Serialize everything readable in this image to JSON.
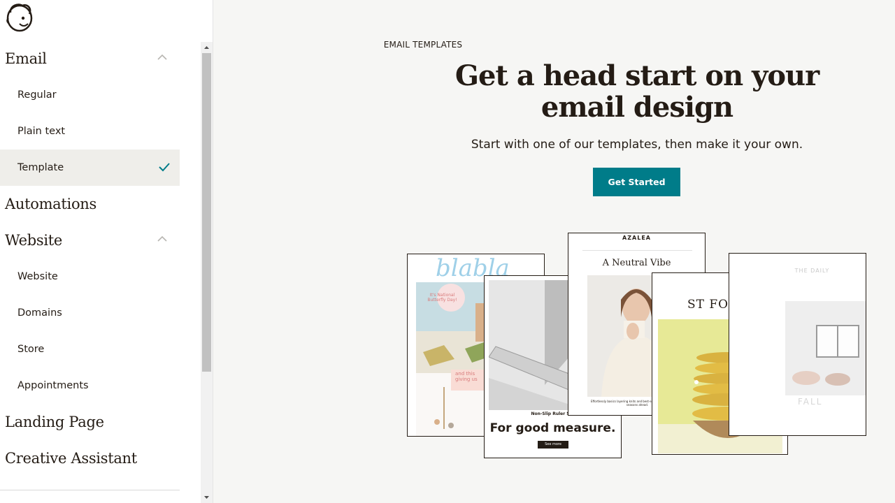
{
  "sidebar": {
    "logo": "mailchimp-freddie-logo",
    "groups": [
      {
        "title": "Email",
        "expanded": true,
        "items": [
          {
            "label": "Regular",
            "selected": false
          },
          {
            "label": "Plain text",
            "selected": false
          },
          {
            "label": "Template",
            "selected": true
          }
        ]
      },
      {
        "title": "Automations",
        "expanded": false,
        "items": []
      },
      {
        "title": "Website",
        "expanded": true,
        "items": [
          {
            "label": "Website",
            "selected": false
          },
          {
            "label": "Domains",
            "selected": false
          },
          {
            "label": "Store",
            "selected": false
          },
          {
            "label": "Appointments",
            "selected": false
          }
        ]
      },
      {
        "title": "Landing Page",
        "expanded": false,
        "items": []
      },
      {
        "title": "Creative Assistant",
        "expanded": false,
        "items": []
      }
    ]
  },
  "main": {
    "eyebrow": "EMAIL TEMPLATES",
    "headline": "Get a head start on your email design",
    "subhead": "Start with one of our templates, then make it your own.",
    "cta_label": "Get Started"
  },
  "cards": {
    "card1": {
      "script": "blabla",
      "bubble": "It's National Butterfly Day!",
      "caption": "and this giving us"
    },
    "card2": {
      "kicker": "Non-Slip Ruler Set",
      "title": "For good measure.",
      "button": "See more"
    },
    "card3": {
      "brand": "AZALEA",
      "title": "A Neutral Vibe",
      "caption": "Effortlessly basics layering knits and best-selling wrap tops for the seasons ahead."
    },
    "card4": {
      "title": "ST FORK"
    },
    "card5": {
      "brand": "THE DAILY",
      "caption": "FALL"
    }
  },
  "colors": {
    "accent": "#007c89",
    "text": "#241c15",
    "selected_bg": "#efeeea",
    "page_bg": "#f6f6f4"
  }
}
